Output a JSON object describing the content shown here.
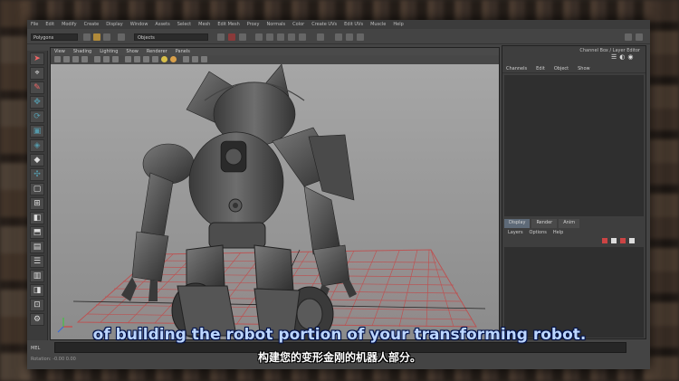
{
  "main_menu": [
    "File",
    "Edit",
    "Modify",
    "Create",
    "Display",
    "Window",
    "Assets",
    "Select",
    "Mesh",
    "Edit Mesh",
    "Proxy",
    "Normals",
    "Color",
    "Create UVs",
    "Edit UVs",
    "Muscle",
    "Help"
  ],
  "status_line": {
    "mode": "Polygons",
    "object_field": "Objects"
  },
  "viewport": {
    "menu": [
      "View",
      "Shading",
      "Lighting",
      "Show",
      "Renderer",
      "Panels"
    ]
  },
  "channel_box": {
    "title": "Channel Box / Layer Editor",
    "menu": [
      "Channels",
      "Edit",
      "Object",
      "Show"
    ]
  },
  "layer_editor": {
    "tabs": [
      "Display",
      "Render",
      "Anim"
    ],
    "active_tab": "Display",
    "menu": [
      "Layers",
      "Options",
      "Help"
    ]
  },
  "command_line": {
    "label": "MEL"
  },
  "help_line": {
    "text": "Rotation:  -0.00    0.00"
  },
  "subtitles": {
    "english": "of building the robot portion of your transforming robot.",
    "chinese": "构建您的变形金刚的机器人部分。"
  },
  "colors": {
    "english_subtitle": "#bcd6ff",
    "grid": "#c24a4a",
    "viewport_bg": "#9a9a9a"
  }
}
